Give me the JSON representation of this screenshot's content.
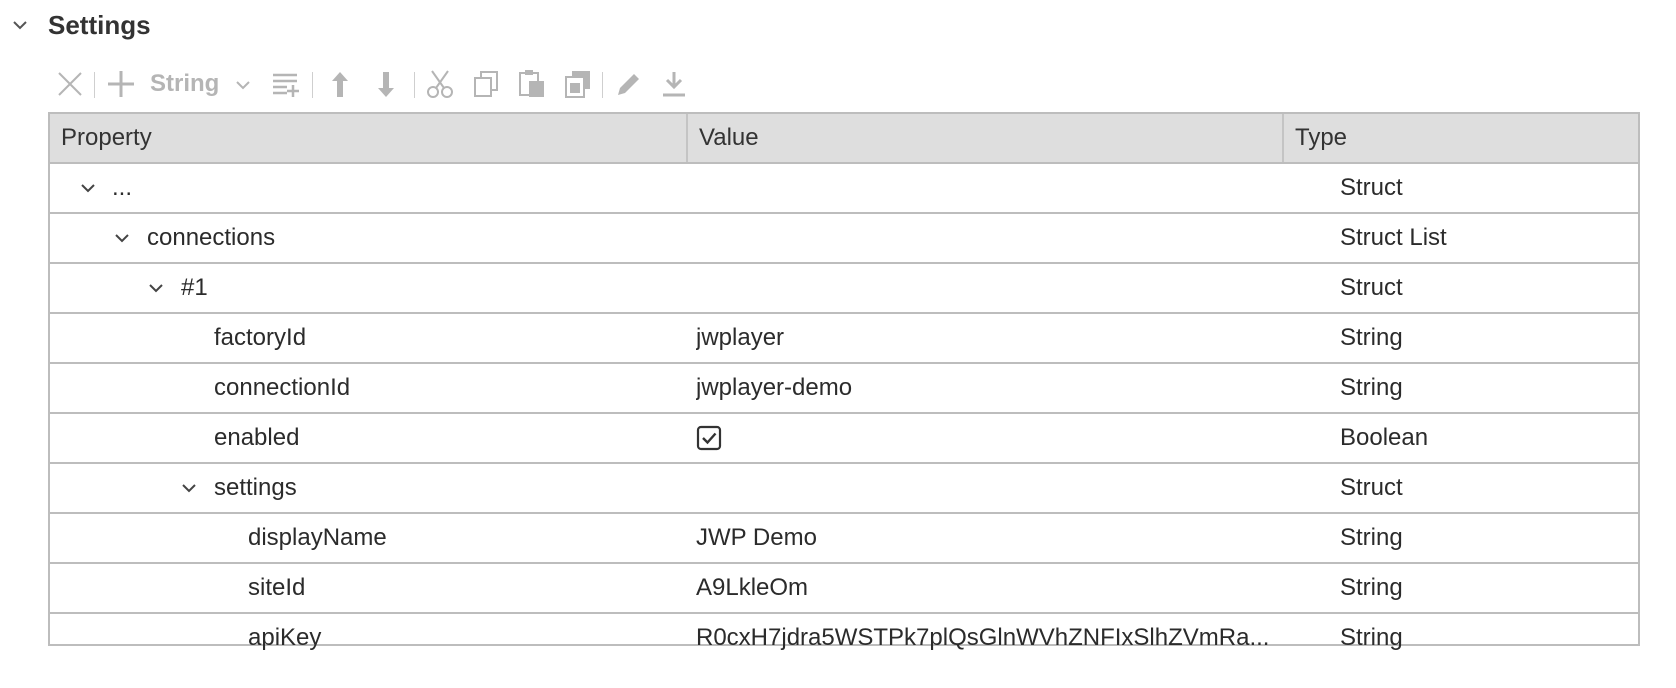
{
  "section": {
    "title": "Settings"
  },
  "toolbar": {
    "type_selector": "String",
    "icons": [
      "close-icon",
      "add-icon",
      "chevron-down-icon",
      "add-list-icon",
      "move-up-icon",
      "move-down-icon",
      "cut-icon",
      "copy-icon",
      "paste-icon",
      "paste-special-icon",
      "edit-icon",
      "download-icon"
    ]
  },
  "grid": {
    "columns": [
      "Property",
      "Value",
      "Type"
    ],
    "rows": [
      {
        "property": "...",
        "value": "",
        "type": "Struct",
        "expandable": true,
        "expanded": true
      },
      {
        "property": "connections",
        "value": "",
        "type": "Struct List",
        "expandable": true,
        "expanded": true
      },
      {
        "property": "#1",
        "value": "",
        "type": "Struct",
        "expandable": true,
        "expanded": true
      },
      {
        "property": "factoryId",
        "value": "jwplayer",
        "type": "String",
        "expandable": false
      },
      {
        "property": "connectionId",
        "value": "jwplayer-demo",
        "type": "String",
        "expandable": false
      },
      {
        "property": "enabled",
        "value": "",
        "checked": true,
        "type": "Boolean",
        "expandable": false
      },
      {
        "property": "settings",
        "value": "",
        "type": "Struct",
        "expandable": true,
        "expanded": true
      },
      {
        "property": "displayName",
        "value": "JWP Demo",
        "type": "String",
        "expandable": false
      },
      {
        "property": "siteId",
        "value": "A9LkleOm",
        "type": "String",
        "expandable": false
      },
      {
        "property": "apiKey",
        "value": "R0cxH7jdra5WSTPk7plQsGlnWVhZNFIxSlhZVmRa...",
        "type": "String",
        "expandable": false
      }
    ]
  },
  "colors": {
    "header_bg": "#dedede",
    "border": "#bdbdbd",
    "disabled_icon": "#b5b5b5",
    "text": "#2b2b2b"
  }
}
